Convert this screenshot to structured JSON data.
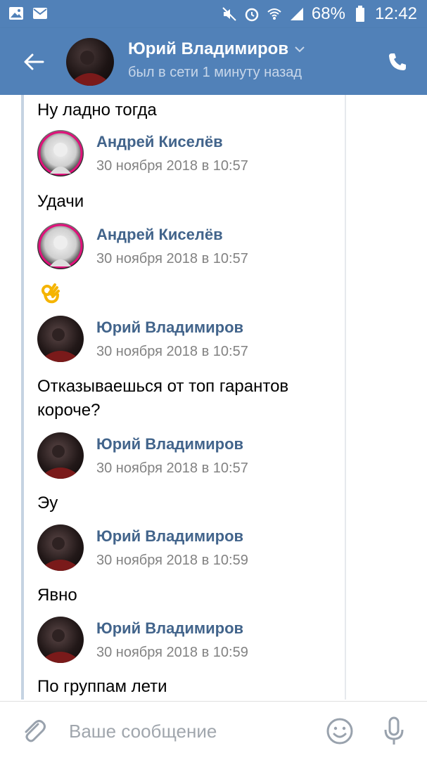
{
  "status_bar": {
    "battery": "68%",
    "time": "12:42"
  },
  "header": {
    "name": "Юрий Владимиров",
    "status": "был в сети 1 минуту назад"
  },
  "messages": [
    {
      "type": "text",
      "text": "Ну ладно тогда"
    },
    {
      "type": "author",
      "name": "Андрей Киселёв",
      "time": "30 ноября 2018 в 10:57"
    },
    {
      "type": "text",
      "text": "Удачи"
    },
    {
      "type": "author",
      "name": "Андрей Киселёв",
      "time": "30 ноября 2018 в 10:57"
    },
    {
      "type": "emoji",
      "icon": "ok-hand-emoji"
    },
    {
      "type": "author",
      "name": "Юрий Владимиров",
      "time": "30 ноября 2018 в 10:57"
    },
    {
      "type": "text",
      "text": "Отказываешься от топ гарантов"
    },
    {
      "type": "text",
      "text": "короче?"
    },
    {
      "type": "author",
      "name": "Юрий Владимиров",
      "time": "30 ноября 2018 в 10:57"
    },
    {
      "type": "text",
      "text": "Эу"
    },
    {
      "type": "author",
      "name": "Юрий Владимиров",
      "time": "30 ноября 2018 в 10:59"
    },
    {
      "type": "text",
      "text": "Явно"
    },
    {
      "type": "author",
      "name": "Юрий Владимиров",
      "time": "30 ноября 2018 в 10:59"
    },
    {
      "type": "text",
      "text": "По группам лети"
    }
  ],
  "composer": {
    "placeholder": "Ваше сообщение"
  },
  "colors": {
    "header_bg": "#5181b8",
    "author_name": "#42648b",
    "timestamp": "#828282"
  }
}
